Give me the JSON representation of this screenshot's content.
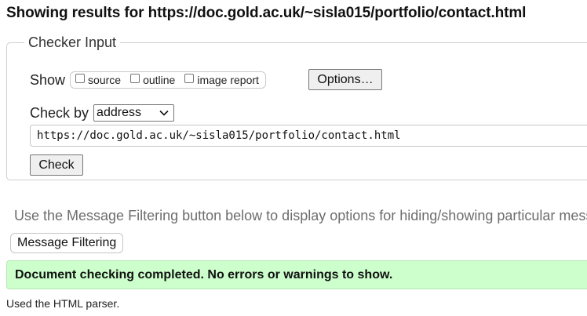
{
  "results_heading": "Showing results for https://doc.gold.ac.uk/~sisla015/portfolio/contact.html",
  "checker": {
    "legend": "Checker Input",
    "show_label": "Show",
    "show_options": [
      {
        "label": "source",
        "checked": false
      },
      {
        "label": "outline",
        "checked": false
      },
      {
        "label": "image report",
        "checked": false
      }
    ],
    "options_button": "Options…",
    "check_by_label": "Check by",
    "check_by_selected": "address",
    "url_value": "https://doc.gold.ac.uk/~sisla015/portfolio/contact.html",
    "check_button": "Check"
  },
  "filter_note": "Use the Message Filtering button below to display options for hiding/showing particular messages, and to see total counts of errors and warnings.",
  "message_filtering_button": "Message Filtering",
  "status_message": "Document checking completed. No errors or warnings to show.",
  "parser_note": "Used the HTML parser.",
  "colors": {
    "success_bg": "#ccffcc",
    "note_text": "#6d6d6d"
  }
}
